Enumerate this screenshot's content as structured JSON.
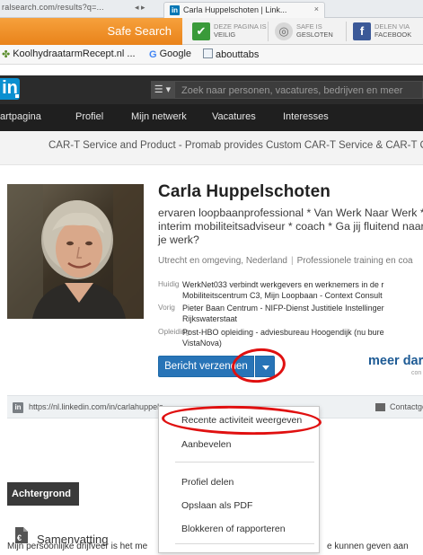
{
  "browser": {
    "tab_strip_left_text": "ralsearch.com/results?q=...",
    "tab_title": "Carla Huppelschoten | Link...",
    "tab_close": "×"
  },
  "toolbar": {
    "safe_search": "Safe Search",
    "items": [
      {
        "line1": "DEZE PAGINA IS",
        "line2": "VEILIG",
        "icon": "check-icon",
        "color": "#3a9a3a"
      },
      {
        "line1": "SAFE IS",
        "line2": "GESLOTEN",
        "icon": "lock-icon",
        "color": "#7a7a7a"
      },
      {
        "line1": "DELEN VIA",
        "line2": "FACEBOOK",
        "icon": "facebook-icon",
        "color": "#3b5998"
      }
    ]
  },
  "bookmarks": [
    {
      "label": "KoolhydraatarmRecept.nl ...",
      "icon": "leaf-icon"
    },
    {
      "label": "Google",
      "icon": "google-icon"
    },
    {
      "label": "abouttabs",
      "icon": "page-icon"
    }
  ],
  "linkedin": {
    "logo": "in",
    "search_placeholder": "Zoek naar personen, vacatures, bedrijven en meer",
    "nav": [
      "artpagina",
      "Profiel",
      "Mijn netwerk",
      "Vacatures",
      "Interesses"
    ],
    "ad": "CAR-T Service and Product - Promab provides Custom CAR-T Service & CAR-T Ce"
  },
  "profile": {
    "name": "Carla Huppelschoten",
    "headline": "ervaren loopbaanprofessional * Van Werk Naar Werk * interim mobiliteitsadviseur * coach * Ga jij fluitend naar je werk?",
    "location": "Utrecht en omgeving, Nederland",
    "industry": "Professionele training en coa",
    "current_label": "Huidig",
    "current": [
      "WerkNet033 verbindt werkgevers en werknemers in de r",
      "Mobiliteitscentrum C3, Mijn Loopbaan - Context Consult"
    ],
    "previous_label": "Vorig",
    "previous": [
      "Pieter Baan Centrum - NIFP-Dienst Justitiele Instellinger",
      "Rijkswaterstaat"
    ],
    "education_label": "Opleiding",
    "education": [
      "Post-HBO opleiding - adviesbureau Hoogendijk (nu bure",
      "VistaNova)"
    ],
    "send_button": "Bericht verzenden",
    "more_text": "meer dar",
    "more_sub": "con",
    "public_url": "https://nl.linkedin.com/in/carlahuppels",
    "contact": "Contactge"
  },
  "dropdown": {
    "items": [
      "Recente activiteit weergeven",
      "Aanbevelen",
      "Profiel delen",
      "Opslaan als PDF",
      "Blokkeren of rapporteren"
    ]
  },
  "sections": {
    "background_tab": "Achtergrond",
    "summary_title": "Samenvatting",
    "summary_left": "Mijn persoonlijke drijfveer is het me",
    "summary_right": "e kunnen geven aan"
  },
  "colors": {
    "linkedin_blue": "#0a8fd0",
    "button_blue": "#2874b7",
    "annotation_red": "#e01010",
    "safe_search_orange": "#f0922a"
  }
}
